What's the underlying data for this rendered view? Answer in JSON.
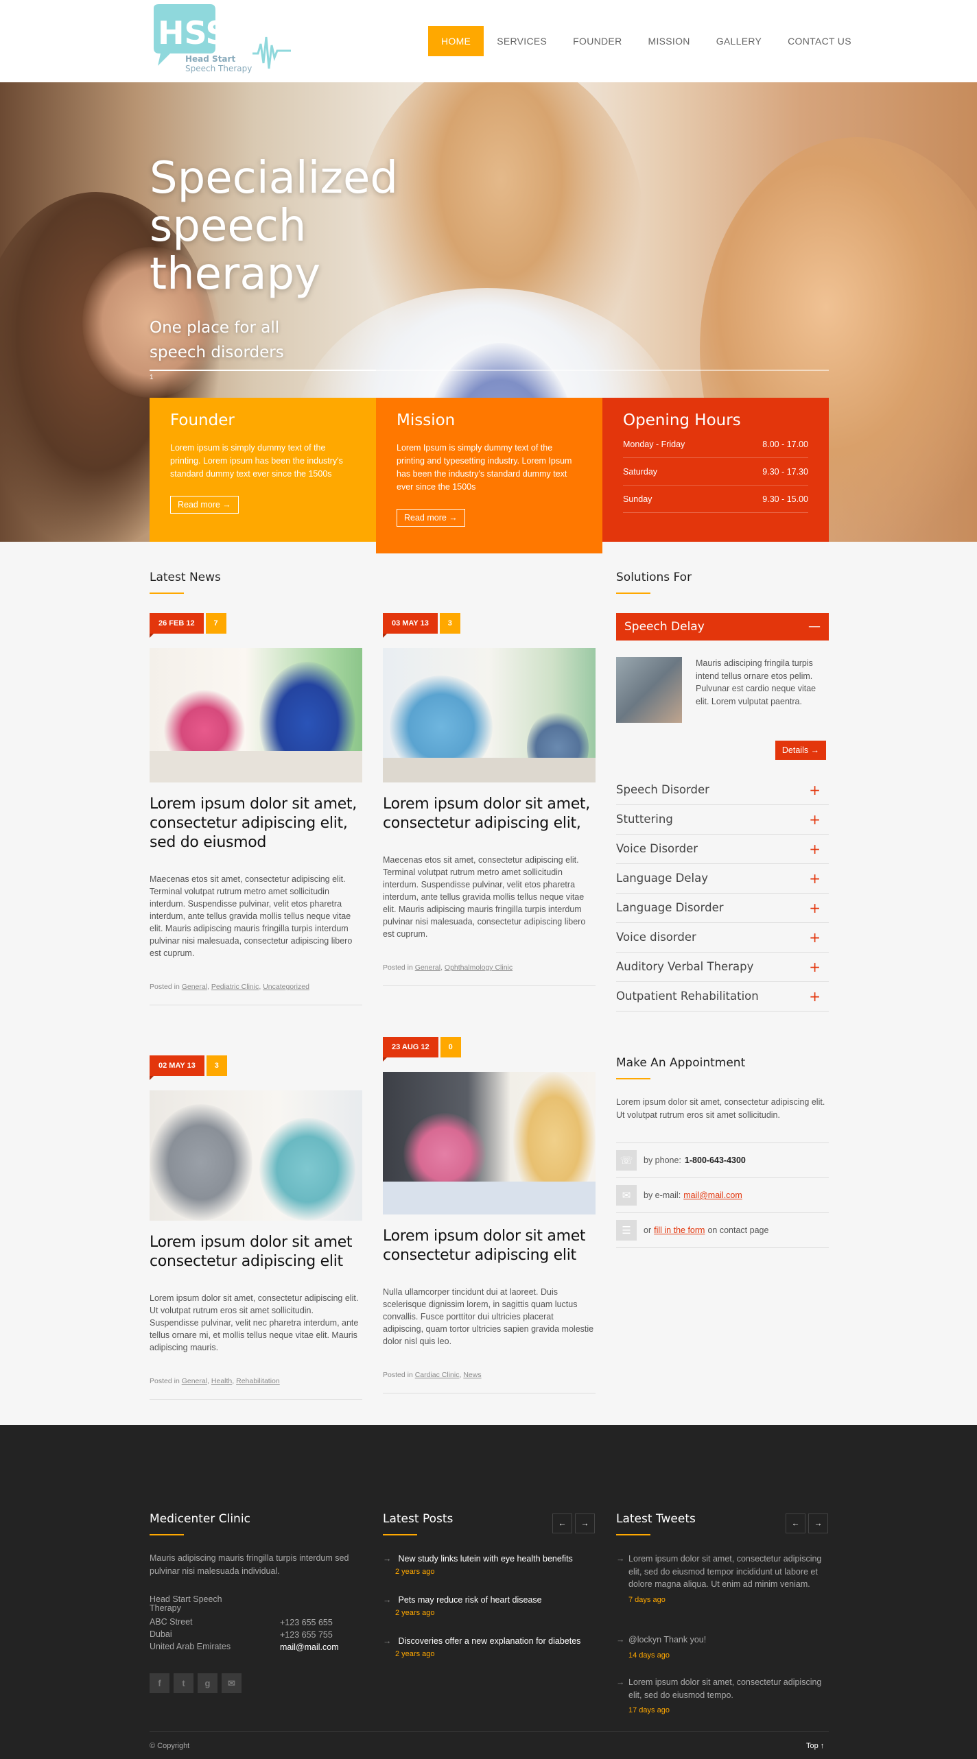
{
  "logo": {
    "letters": "HSST",
    "line1": "Head Start",
    "line2": "Speech Therapy"
  },
  "nav": [
    "HOME",
    "SERVICES",
    "FOUNDER",
    "MISSION",
    "GALLERY",
    "CONTACT US"
  ],
  "hero": {
    "title": "Specialized speech therapy",
    "subtitle": "One place for all speech disorders",
    "slide_number": "1"
  },
  "founder": {
    "title": "Founder",
    "text": "Lorem ipsum is simply dummy text of the printing. Lorem ipsum has been the industry's standard dummy text ever since the 1500s",
    "button": "Read more →"
  },
  "mission": {
    "title": "Mission",
    "text": "Lorem Ipsum is simply dummy text of the printing and typesetting industry. Lorem Ipsum has been the industry's standard dummy text ever since the 1500s",
    "button": "Read more →"
  },
  "hours": {
    "title": "Opening Hours",
    "rows": [
      {
        "day": "Monday - Friday",
        "time": "8.00 - 17.00"
      },
      {
        "day": "Saturday",
        "time": "9.30 - 17.30"
      },
      {
        "day": "Sunday",
        "time": "9.30 - 15.00"
      }
    ]
  },
  "news": {
    "title": "Latest News",
    "posts": [
      {
        "date": "26 FEB 12",
        "comments": "7",
        "title": "Lorem ipsum dolor sit amet, consectetur adipiscing elit, sed do eiusmod",
        "text": "Maecenas etos sit amet, consectetur adipiscing elit. Terminal volutpat rutrum metro amet sollicitudin interdum. Suspendisse pulvinar, velit etos pharetra interdum, ante tellus gravida mollis tellus neque vitae elit. Mauris adipiscing mauris fringilla turpis interdum pulvinar nisi malesuada, consectetur adipiscing libero est cuprum.",
        "posted_in": "Posted in",
        "cats": [
          "General",
          "Pediatric Clinic",
          "Uncategorized"
        ]
      },
      {
        "date": "03 MAY 13",
        "comments": "3",
        "title": "Lorem ipsum dolor sit amet, consectetur adipiscing elit,",
        "text": "Maecenas etos sit amet, consectetur adipiscing elit. Terminal volutpat rutrum metro amet sollicitudin interdum. Suspendisse pulvinar, velit etos pharetra interdum, ante tellus gravida mollis tellus neque vitae elit. Mauris adipiscing mauris fringilla turpis interdum pulvinar nisi malesuada, consectetur adipiscing libero est cuprum.",
        "posted_in": "Posted in",
        "cats": [
          "General",
          "Ophthalmology Clinic"
        ]
      },
      {
        "date": "02 MAY 13",
        "comments": "3",
        "title": "Lorem ipsum dolor sit amet consectetur adipiscing elit",
        "text": "Lorem ipsum dolor sit amet, consectetur adipiscing elit. Ut volutpat rutrum eros sit amet sollicitudin. Suspendisse pulvinar, velit nec pharetra interdum, ante tellus ornare mi, et mollis tellus neque vitae elit. Mauris adipiscing mauris.",
        "posted_in": "Posted in",
        "cats": [
          "General",
          "Health",
          "Rehabilitation"
        ]
      },
      {
        "date": "23 AUG 12",
        "comments": "0",
        "title": "Lorem ipsum dolor sit amet consectetur adipiscing elit",
        "text": "Nulla ullamcorper tincidunt dui at laoreet. Duis scelerisque dignissim lorem, in sagittis quam luctus convallis. Fusce porttitor dui ultricies placerat adipiscing, quam tortor ultricies sapien gravida molestie dolor nisl quis leo.",
        "posted_in": "Posted in",
        "cats": [
          "Cardiac Clinic",
          "News"
        ]
      }
    ]
  },
  "solutions": {
    "title": "Solutions For",
    "open": {
      "title": "Speech Delay",
      "icon": "minus-icon",
      "text": "Mauris adisciping fringila turpis intend tellus ornare etos pelim. Pulvunar est cardio neque vitae elit. Lorem vulputat paentra.",
      "button": "Details →"
    },
    "items": [
      "Speech Disorder",
      "Stuttering",
      "Voice Disorder",
      "Language Delay",
      "Language Disorder",
      "Voice disorder",
      "Auditory Verbal Therapy",
      "Outpatient Rehabilitation"
    ]
  },
  "appointment": {
    "title": "Make An Appointment",
    "text": "Lorem ipsum dolor sit amet, consectetur adipiscing elit. Ut volutpat rutrum eros sit amet sollicitudin.",
    "phone_label": "by phone:",
    "phone": "1-800-643-4300",
    "email_label": "by e-mail:",
    "email": "mail@mail.com",
    "form_pre": "or",
    "form_link": "fill in the form",
    "form_post": "on contact page"
  },
  "footer": {
    "clinic": {
      "title": "Medicenter Clinic",
      "text": "Mauris adipiscing mauris fringilla turpis interdum sed pulvinar nisi malesuada individual.",
      "address": [
        "Head Start Speech Therapy",
        "ABC Street",
        "Dubai",
        "United Arab Emirates"
      ],
      "phones": [
        "+123 655 655",
        "+123 655 755"
      ],
      "email": "mail@mail.com"
    },
    "posts": {
      "title": "Latest Posts",
      "items": [
        {
          "title": "New study links lutein with eye health benefits",
          "when": "2 years ago"
        },
        {
          "title": "Pets may reduce risk of heart disease",
          "when": "2 years ago"
        },
        {
          "title": "Discoveries offer a new explanation for diabetes",
          "when": "2 years ago"
        }
      ]
    },
    "tweets": {
      "title": "Latest Tweets",
      "items": [
        {
          "text": "Lorem ipsum dolor sit amet, consectetur adipiscing elit, sed do eiusmod tempor incididunt ut labore et dolore magna aliqua. Ut enim ad minim veniam.",
          "when": "7 days ago"
        },
        {
          "text": "@lockyn Thank you!",
          "when": "14 days ago"
        },
        {
          "text": "Lorem ipsum dolor sit amet, consectetur adipiscing elit, sed do eiusmod tempo.",
          "when": "17 days ago"
        }
      ]
    },
    "copyright": "© Copyright",
    "top": "Top ↑"
  },
  "colors": {
    "orange": "#ffa800",
    "dark_orange": "#ff7800",
    "red": "#e3360c",
    "footer_bg": "#232323"
  }
}
